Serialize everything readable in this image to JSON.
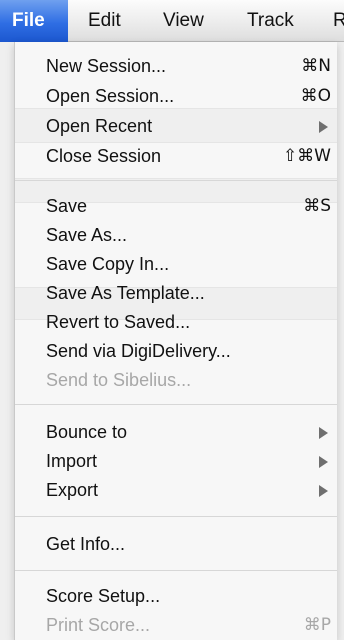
{
  "menubar": {
    "items": [
      {
        "label": "File"
      },
      {
        "label": "Edit"
      },
      {
        "label": "View"
      },
      {
        "label": "Track"
      },
      {
        "label": "R"
      }
    ]
  },
  "menu": {
    "items": [
      {
        "label": "New Session...",
        "shortcut": "⌘N"
      },
      {
        "label": "Open Session...",
        "shortcut": "⌘O"
      },
      {
        "label": "Open Recent"
      },
      {
        "label": "Close Session",
        "shortcut": "⇧⌘W"
      },
      {
        "label": "Save",
        "shortcut": "⌘S"
      },
      {
        "label": "Save As..."
      },
      {
        "label": "Save Copy In..."
      },
      {
        "label": "Save As Template..."
      },
      {
        "label": "Revert to Saved..."
      },
      {
        "label": "Send via DigiDelivery..."
      },
      {
        "label": "Send to Sibelius..."
      },
      {
        "label": "Bounce to"
      },
      {
        "label": "Import"
      },
      {
        "label": "Export"
      },
      {
        "label": "Get Info..."
      },
      {
        "label": "Score Setup..."
      },
      {
        "label": "Print Score...",
        "shortcut": "⌘P"
      }
    ]
  }
}
